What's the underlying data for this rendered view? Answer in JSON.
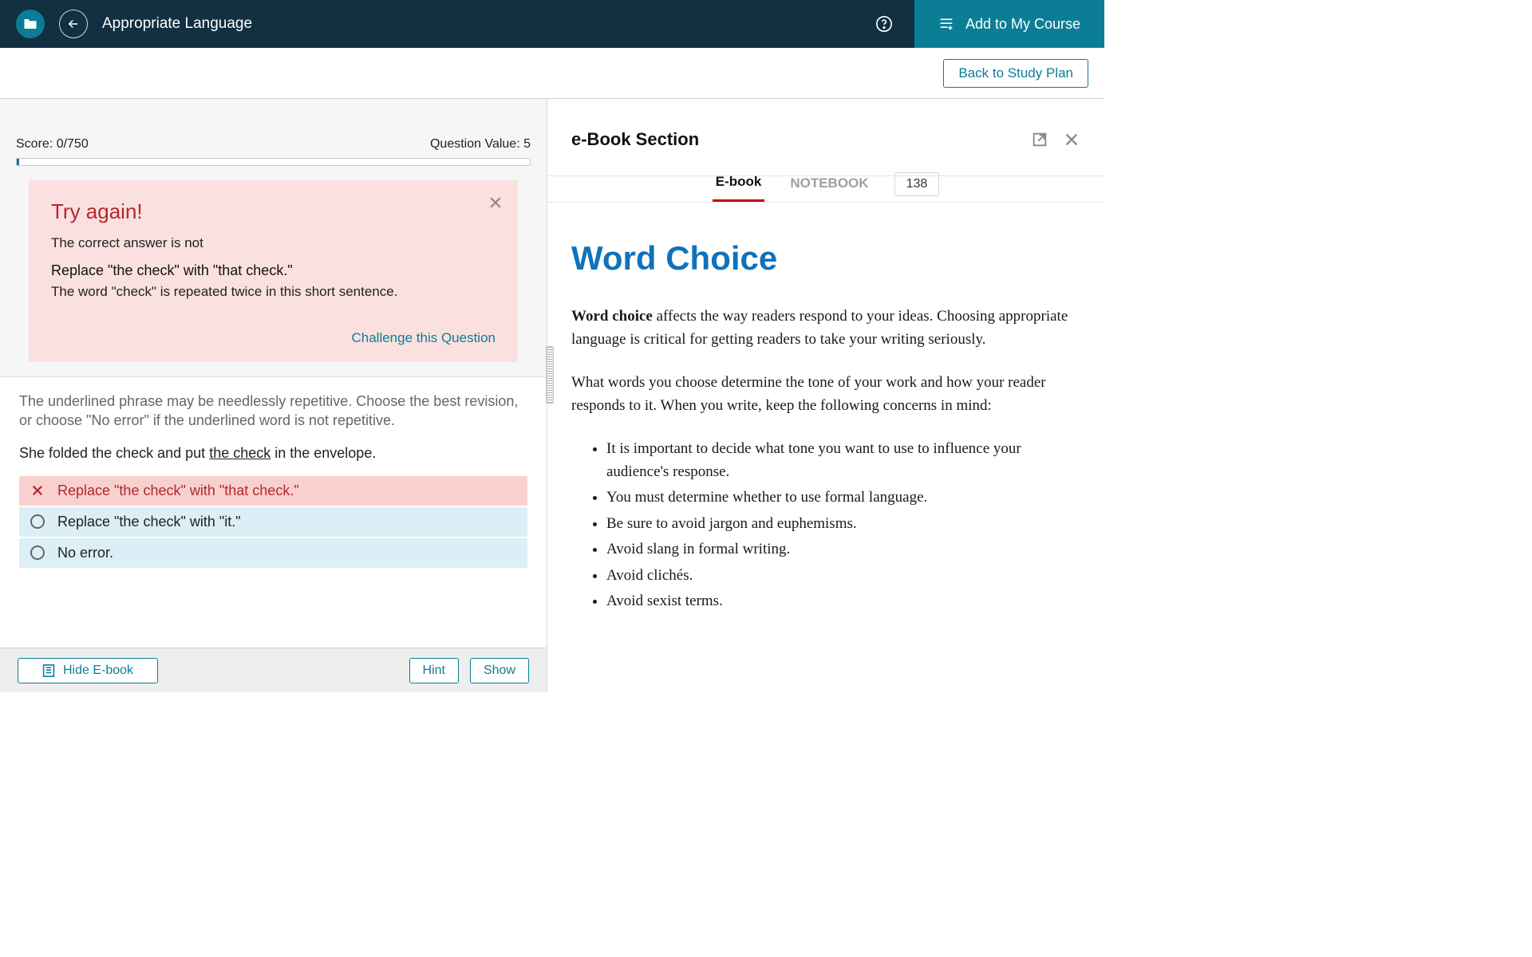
{
  "header": {
    "title": "Appropriate Language",
    "add_course_label": "Add to My Course"
  },
  "subheader": {
    "back_plan_label": "Back to Study Plan"
  },
  "quiz": {
    "score_label": "Score: 0/750",
    "question_value_label": "Question Value: 5",
    "feedback": {
      "title": "Try again!",
      "line1": "The correct answer is not",
      "strong": "Replace \"the check\" with \"that check.\"",
      "explain": "The word \"check\" is repeated twice in this short sentence.",
      "challenge_label": "Challenge this Question"
    },
    "instruction": "The underlined phrase may be needlessly repetitive. Choose the best revision, or choose \"No error\" if the underlined word is not repetitive.",
    "sentence_pre": "She folded the check and put ",
    "sentence_underlined": "the check",
    "sentence_post": " in the envelope.",
    "choices": [
      {
        "text": "Replace \"the check\" with \"that check.\"",
        "state": "wrong"
      },
      {
        "text": "Replace \"the check\" with \"it.\"",
        "state": "normal"
      },
      {
        "text": "No error.",
        "state": "normal"
      }
    ],
    "footer": {
      "hide_ebook_label": "Hide E-book",
      "hint_label": "Hint",
      "show_label": "Show"
    }
  },
  "ebook": {
    "section_title": "e-Book Section",
    "tabs": {
      "ebook": "E-book",
      "notebook": "NOTEBOOK",
      "page": "138"
    },
    "h1": "Word Choice",
    "p1_bold": "Word choice",
    "p1_rest": " affects the way readers respond to your ideas. Choosing appropriate language is critical for getting readers to take your writing seriously.",
    "p2": "What words you choose determine the tone of your work and how your reader responds to it. When you write, keep the following concerns in mind:",
    "bullets": [
      "It is important to decide what tone you want to use to influence your audience's response.",
      "You must determine whether to use formal language.",
      "Be sure to avoid jargon and euphemisms.",
      "Avoid slang in formal writing.",
      "Avoid clichés.",
      "Avoid sexist terms."
    ]
  }
}
